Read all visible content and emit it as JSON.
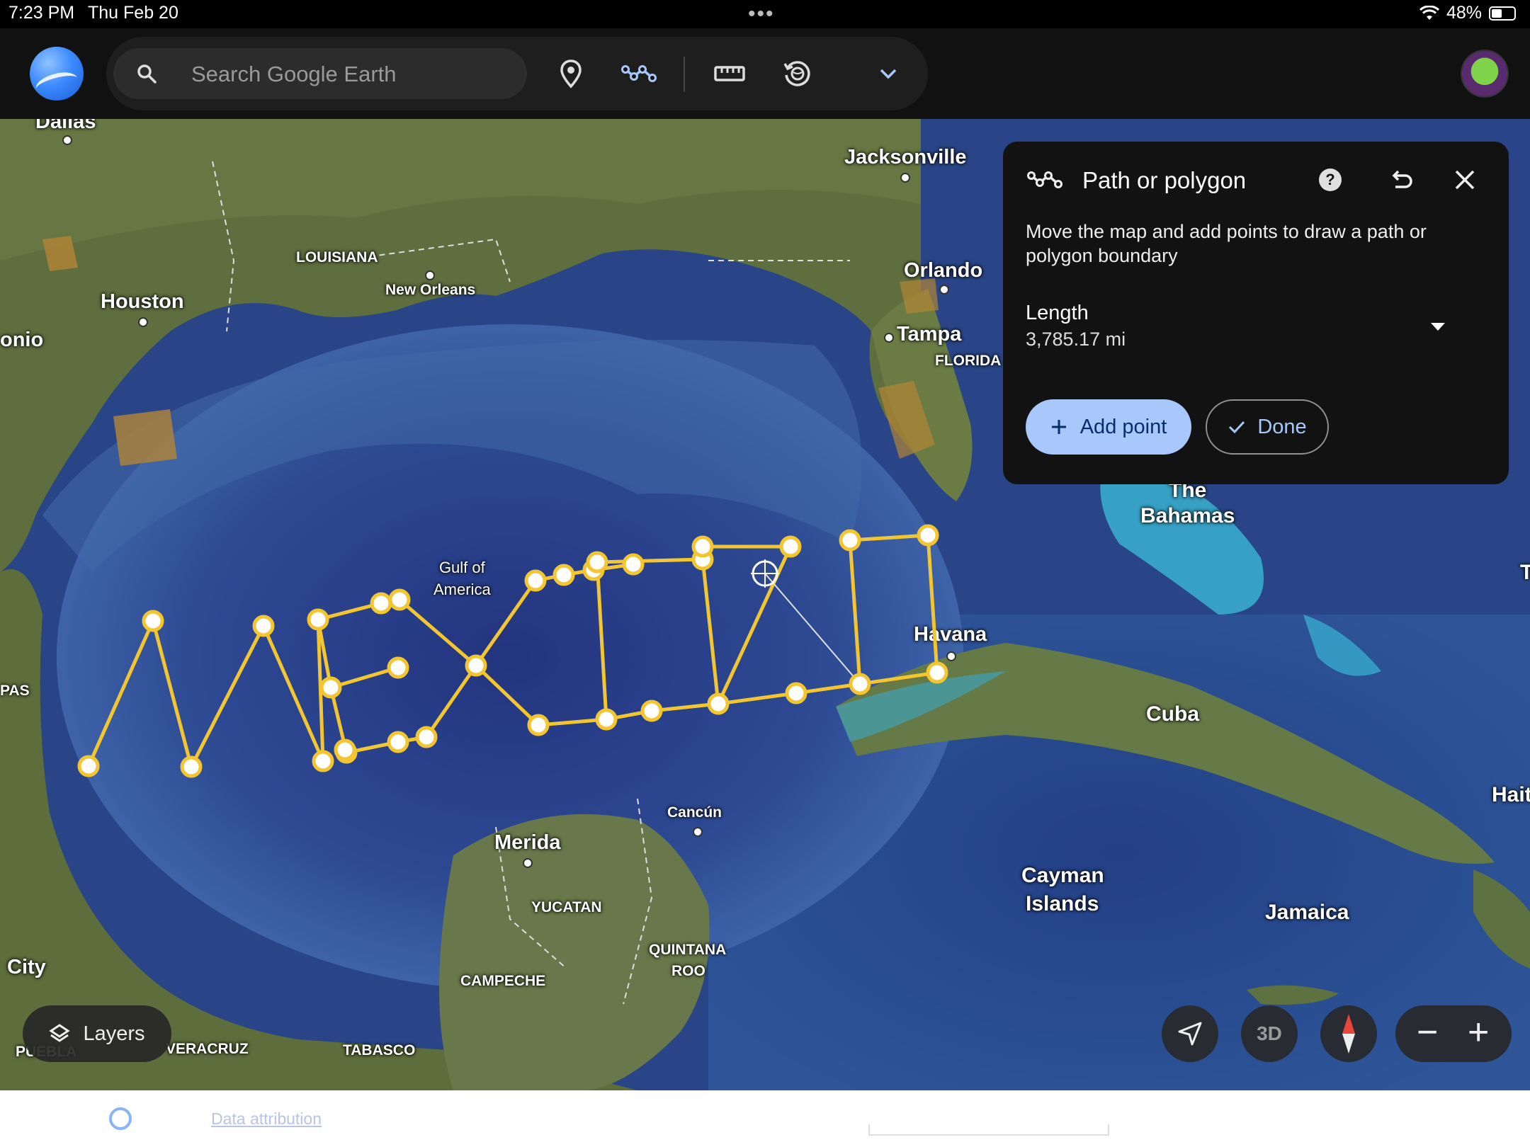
{
  "status_bar": {
    "time": "7:23 PM",
    "date": "Thu Feb 20",
    "battery": "48%",
    "battery_level": 0.48
  },
  "search": {
    "placeholder": "Search Google Earth"
  },
  "toolbar": {
    "icons": [
      "search-icon",
      "place-marker-icon",
      "path-icon",
      "ruler-icon",
      "history-icon",
      "chevron-down-icon"
    ]
  },
  "panel": {
    "title": "Path or polygon",
    "description": "Move the map and add points to draw a path or polygon boundary",
    "length_label": "Length",
    "length_value": "3,785.17 mi",
    "add_point_label": "Add point",
    "done_label": "Done"
  },
  "map_labels": {
    "dallas": "Dallas",
    "jacksonville": "Jacksonville",
    "louisiana": "LOUISIANA",
    "new_orleans": "New Orleans",
    "houston": "Houston",
    "antonio": "onio",
    "orlando": "Orlando",
    "tampa": "Tampa",
    "florida": "FLORIDA",
    "bahamas_1": "The",
    "bahamas_2": "Bahamas",
    "gulf_1": "Gulf of",
    "gulf_2": "America",
    "havana": "Havana",
    "cuba": "Cuba",
    "pas": "PAS",
    "cancun": "Cancún",
    "merida": "Merida",
    "yucatan": "YUCATAN",
    "cayman_1": "Cayman",
    "cayman_2": "Islands",
    "jamaica": "Jamaica",
    "haiti": "Hait",
    "edge_t": "T",
    "quintana_1": "QUINTANA",
    "quintana_2": "ROO",
    "campeche": "CAMPECHE",
    "city": "City",
    "puebla": "PUEBLA",
    "veracruz": "VERACRUZ",
    "tabasco": "TABASCO"
  },
  "map_controls": {
    "layers_label": "Layers",
    "three_d_label": "3D",
    "zoom_out": "−",
    "zoom_in": "+"
  },
  "footer": {
    "attribution": "Data attribution"
  },
  "colors": {
    "path": "#f2c531",
    "panel_bg": "#121212",
    "accent": "#a8c7fa"
  }
}
